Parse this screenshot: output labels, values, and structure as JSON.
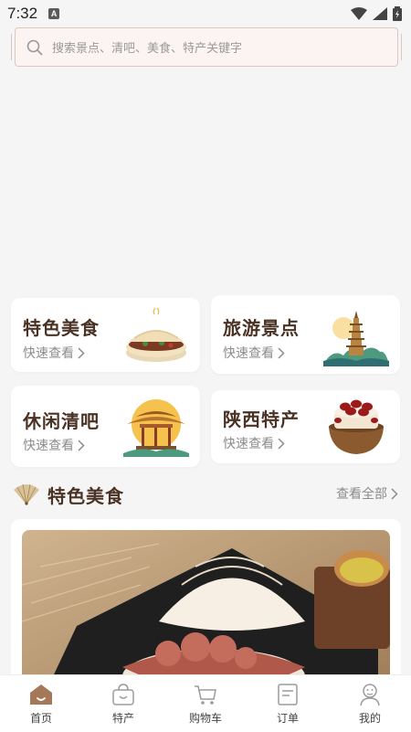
{
  "status": {
    "time": "7:32",
    "notif_letter": "A"
  },
  "search": {
    "placeholder": "搜索景点、清吧、美食、特产关键字"
  },
  "categories": [
    {
      "title": "特色美食",
      "sub": "快速查看",
      "icon": "roujiamo-icon"
    },
    {
      "title": "旅游景点",
      "sub": "快速查看",
      "icon": "pagoda-icon"
    },
    {
      "title": "休闲清吧",
      "sub": "快速查看",
      "icon": "pavilion-icon"
    },
    {
      "title": "陕西特产",
      "sub": "快速查看",
      "icon": "date-cake-icon"
    }
  ],
  "section": {
    "title": "特色美食",
    "more": "查看全部"
  },
  "tabs": [
    {
      "label": "首页",
      "icon": "home-icon",
      "active": true
    },
    {
      "label": "特产",
      "icon": "bag-icon"
    },
    {
      "label": "购物车",
      "icon": "cart-icon"
    },
    {
      "label": "订单",
      "icon": "order-icon"
    },
    {
      "label": "我的",
      "icon": "profile-icon"
    }
  ],
  "colors": {
    "accent": "#4a3224",
    "background": "#f6f5f5",
    "search_bg": "#fbf4f2"
  }
}
